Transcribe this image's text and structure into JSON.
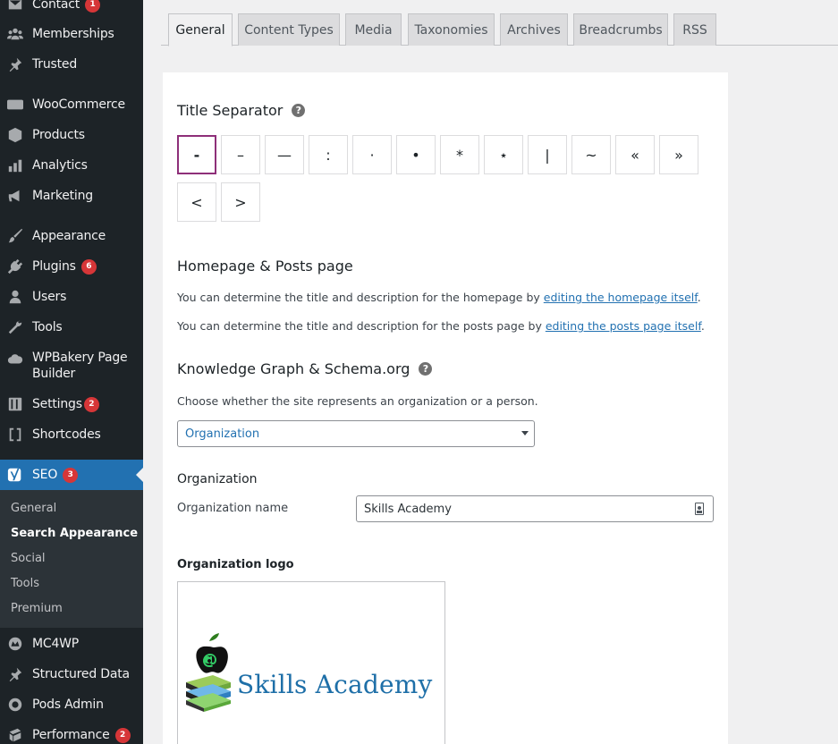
{
  "sidebar": {
    "items": [
      {
        "label": "Contact",
        "icon": "envelope-icon",
        "badge": "1"
      },
      {
        "label": "Memberships",
        "icon": "groups-icon",
        "badge": ""
      },
      {
        "label": "Trusted",
        "icon": "pin-icon",
        "badge": ""
      },
      {
        "label": "WooCommerce",
        "icon": "woo-icon",
        "badge": ""
      },
      {
        "label": "Products",
        "icon": "archive-box-icon",
        "badge": ""
      },
      {
        "label": "Analytics",
        "icon": "bar-chart-icon",
        "badge": ""
      },
      {
        "label": "Marketing",
        "icon": "megaphone-icon",
        "badge": ""
      },
      {
        "label": "Appearance",
        "icon": "paintbrush-icon",
        "badge": ""
      },
      {
        "label": "Plugins",
        "icon": "plug-icon",
        "badge": "6"
      },
      {
        "label": "Users",
        "icon": "user-icon",
        "badge": ""
      },
      {
        "label": "Tools",
        "icon": "wrench-icon",
        "badge": ""
      },
      {
        "label": "WPBakery Page Builder",
        "icon": "cloud-icon",
        "badge": ""
      },
      {
        "label": "Settings",
        "icon": "sliders-icon",
        "badge": "2"
      },
      {
        "label": "Shortcodes",
        "icon": "brackets-icon",
        "badge": ""
      },
      {
        "label": "SEO",
        "icon": "yoast-icon",
        "badge": "3"
      },
      {
        "label": "MC4WP",
        "icon": "mc4wp-icon",
        "badge": ""
      },
      {
        "label": "Structured Data",
        "icon": "pin-icon",
        "badge": ""
      },
      {
        "label": "Pods Admin",
        "icon": "pods-icon",
        "badge": ""
      },
      {
        "label": "Performance",
        "icon": "performance-icon",
        "badge": "2"
      }
    ],
    "submenu": [
      "General",
      "Search Appearance",
      "Social",
      "Tools",
      "Premium"
    ]
  },
  "tabs": [
    "General",
    "Content Types",
    "Media",
    "Taxonomies",
    "Archives",
    "Breadcrumbs",
    "RSS"
  ],
  "title_separator": {
    "heading": "Title Separator",
    "options": [
      "-",
      "–",
      "—",
      ":",
      "·",
      "•",
      "*",
      "⋆",
      "|",
      "~",
      "«",
      "»",
      "<",
      ">"
    ],
    "selected": "-"
  },
  "homepage": {
    "heading": "Homepage & Posts page",
    "line1_text": "You can determine the title and description for the homepage by ",
    "line1_link": "editing the homepage itself",
    "line2_text": "You can determine the title and description for the posts page by ",
    "line2_link": "editing the posts page itself",
    "period": "."
  },
  "knowledge_graph": {
    "heading": "Knowledge Graph & Schema.org",
    "description": "Choose whether the site represents an organization or a person.",
    "selected": "Organization"
  },
  "organization": {
    "heading": "Organization",
    "name_label": "Organization name",
    "name_value": "Skills Academy",
    "logo_label": "Organization logo",
    "logo_text": "Skills Academy"
  },
  "colors": {
    "admin_bg": "#1d2327",
    "active_blue": "#2271b1",
    "selected_border": "#8e2f79",
    "badge_red": "#d63638"
  }
}
